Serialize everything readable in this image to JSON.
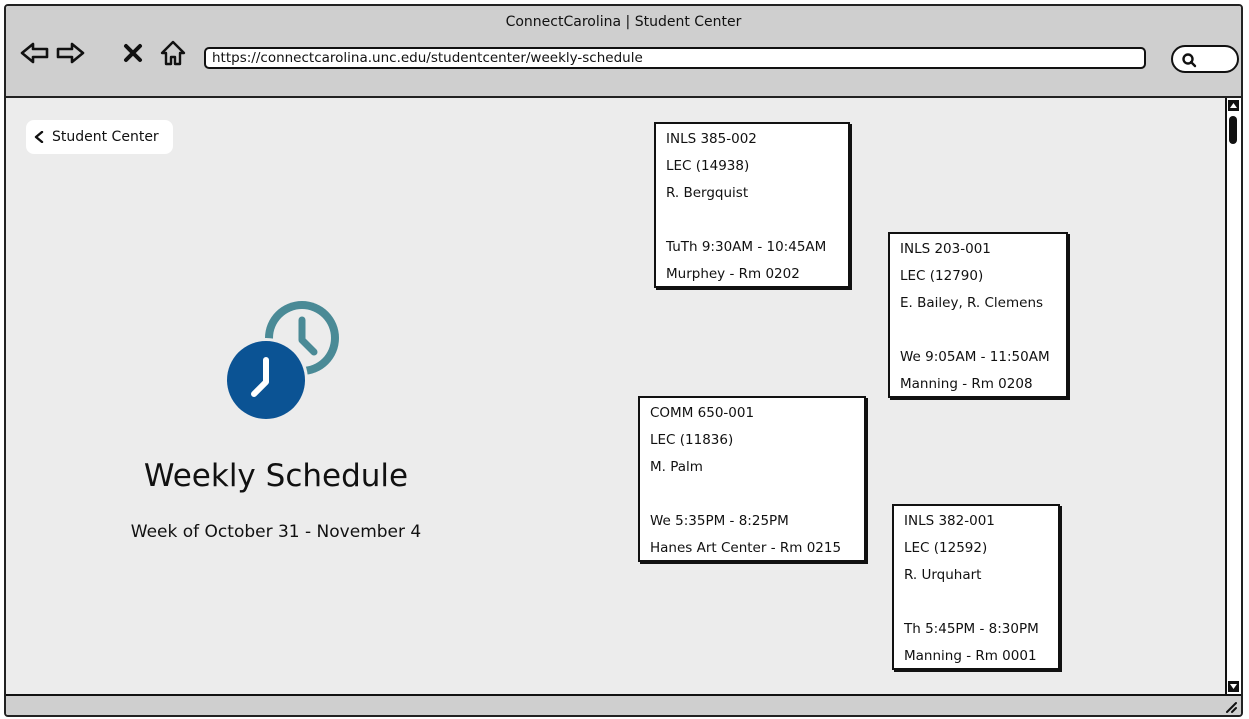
{
  "window": {
    "title": "ConnectCarolina | Student Center"
  },
  "toolbar": {
    "back_icon": "back-arrow-icon",
    "forward_icon": "forward-arrow-icon",
    "stop_icon": "close-x-icon",
    "home_icon": "home-icon",
    "url": "https://connectcarolina.unc.edu/studentcenter/weekly-schedule",
    "search_icon": "search-icon"
  },
  "page": {
    "back_link_label": "Student Center",
    "title": "Weekly Schedule",
    "subtitle": "Week of October 31 - November 4",
    "icon": "clock-icon"
  },
  "courses": [
    {
      "code": "INLS 385-002",
      "section": "LEC (14938)",
      "instructor": "R. Bergquist",
      "time": "TuTh 9:30AM - 10:45AM",
      "location": "Murphey - Rm 0202"
    },
    {
      "code": "INLS 203-001",
      "section": "LEC (12790)",
      "instructor": "E. Bailey, R. Clemens",
      "time": "We 9:05AM - 11:50AM",
      "location": "Manning - Rm 0208"
    },
    {
      "code": "COMM 650-001",
      "section": "LEC (11836)",
      "instructor": "M. Palm",
      "time": "We 5:35PM - 8:25PM",
      "location": "Hanes Art Center - Rm 0215"
    },
    {
      "code": "INLS 382-001",
      "section": "LEC (12592)",
      "instructor": "R. Urquhart",
      "time": "Th 5:45PM - 8:30PM",
      "location": "Manning - Rm 0001"
    }
  ],
  "colors": {
    "clock_front": "#0b5394",
    "clock_back": "#4a8a96"
  }
}
